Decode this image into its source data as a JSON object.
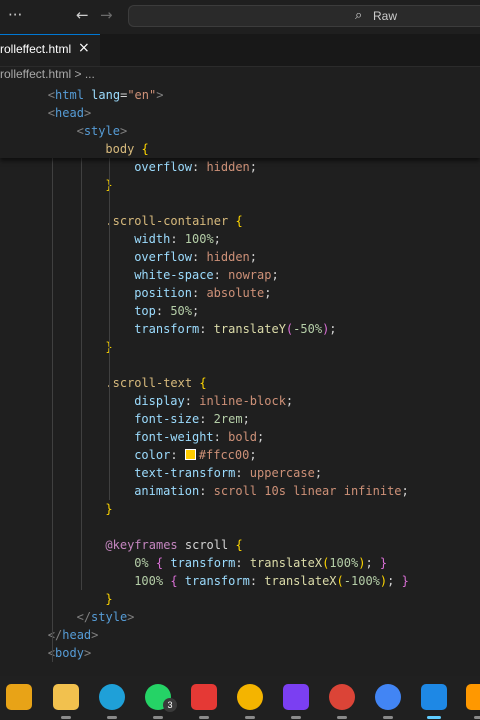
{
  "titlebar": {
    "menu_label": "···",
    "back_label": "←",
    "forward_label": "→",
    "search_placeholder": "Raw"
  },
  "tab": {
    "label": "rolleffect.html",
    "close_label": "×"
  },
  "breadcrumb": {
    "file": "rolleffect.html",
    "separator": ">",
    "more": "..."
  },
  "sticky_lines": [
    {
      "indent": 1,
      "tokens": [
        [
          "punct",
          "<"
        ],
        [
          "tag",
          "html"
        ],
        [
          "plain",
          " "
        ],
        [
          "attr",
          "lang"
        ],
        [
          "plain",
          "="
        ],
        [
          "str",
          "\"en\""
        ],
        [
          "punct",
          ">"
        ]
      ]
    },
    {
      "indent": 1,
      "tokens": [
        [
          "punct",
          "<"
        ],
        [
          "tag",
          "head"
        ],
        [
          "punct",
          ">"
        ]
      ]
    },
    {
      "indent": 2,
      "tokens": [
        [
          "punct",
          "<"
        ],
        [
          "tag",
          "style"
        ],
        [
          "punct",
          ">"
        ]
      ]
    },
    {
      "indent": 3,
      "tokens": [
        [
          "sel",
          "body"
        ],
        [
          "plain",
          " "
        ],
        [
          "brace",
          "{"
        ]
      ]
    }
  ],
  "code_lines": [
    {
      "indent": 4,
      "tokens": [
        [
          "prop",
          "overflow"
        ],
        [
          "plain",
          ": "
        ],
        [
          "val",
          "hidden"
        ],
        [
          "plain",
          ";"
        ]
      ]
    },
    {
      "indent": 3,
      "tokens": [
        [
          "brace",
          "}"
        ]
      ]
    },
    {
      "indent": 0,
      "tokens": []
    },
    {
      "indent": 3,
      "tokens": [
        [
          "sel",
          ".scroll-container"
        ],
        [
          "plain",
          " "
        ],
        [
          "brace",
          "{"
        ]
      ]
    },
    {
      "indent": 4,
      "tokens": [
        [
          "prop",
          "width"
        ],
        [
          "plain",
          ": "
        ],
        [
          "num",
          "100%"
        ],
        [
          "plain",
          ";"
        ]
      ]
    },
    {
      "indent": 4,
      "tokens": [
        [
          "prop",
          "overflow"
        ],
        [
          "plain",
          ": "
        ],
        [
          "val",
          "hidden"
        ],
        [
          "plain",
          ";"
        ]
      ]
    },
    {
      "indent": 4,
      "tokens": [
        [
          "prop",
          "white-space"
        ],
        [
          "plain",
          ": "
        ],
        [
          "val",
          "nowrap"
        ],
        [
          "plain",
          ";"
        ]
      ]
    },
    {
      "indent": 4,
      "tokens": [
        [
          "prop",
          "position"
        ],
        [
          "plain",
          ": "
        ],
        [
          "val",
          "absolute"
        ],
        [
          "plain",
          ";"
        ]
      ]
    },
    {
      "indent": 4,
      "tokens": [
        [
          "prop",
          "top"
        ],
        [
          "plain",
          ": "
        ],
        [
          "num",
          "50%"
        ],
        [
          "plain",
          ";"
        ]
      ]
    },
    {
      "indent": 4,
      "tokens": [
        [
          "prop",
          "transform"
        ],
        [
          "plain",
          ": "
        ],
        [
          "func",
          "translateY"
        ],
        [
          "brace2",
          "("
        ],
        [
          "num",
          "-50%"
        ],
        [
          "brace2",
          ")"
        ],
        [
          "plain",
          ";"
        ]
      ]
    },
    {
      "indent": 3,
      "tokens": [
        [
          "brace",
          "}"
        ]
      ]
    },
    {
      "indent": 0,
      "tokens": []
    },
    {
      "indent": 3,
      "tokens": [
        [
          "sel",
          ".scroll-text"
        ],
        [
          "plain",
          " "
        ],
        [
          "brace",
          "{"
        ]
      ]
    },
    {
      "indent": 4,
      "tokens": [
        [
          "prop",
          "display"
        ],
        [
          "plain",
          ": "
        ],
        [
          "val",
          "inline-block"
        ],
        [
          "plain",
          ";"
        ]
      ]
    },
    {
      "indent": 4,
      "tokens": [
        [
          "prop",
          "font-size"
        ],
        [
          "plain",
          ": "
        ],
        [
          "num",
          "2rem"
        ],
        [
          "plain",
          ";"
        ]
      ]
    },
    {
      "indent": 4,
      "tokens": [
        [
          "prop",
          "font-weight"
        ],
        [
          "plain",
          ": "
        ],
        [
          "val",
          "bold"
        ],
        [
          "plain",
          ";"
        ]
      ]
    },
    {
      "indent": 4,
      "tokens": [
        [
          "prop",
          "color"
        ],
        [
          "plain",
          ": "
        ],
        [
          "swatch",
          ""
        ],
        [
          "val",
          "#ffcc00"
        ],
        [
          "plain",
          ";"
        ]
      ]
    },
    {
      "indent": 4,
      "tokens": [
        [
          "prop",
          "text-transform"
        ],
        [
          "plain",
          ": "
        ],
        [
          "val",
          "uppercase"
        ],
        [
          "plain",
          ";"
        ]
      ]
    },
    {
      "indent": 4,
      "tokens": [
        [
          "prop",
          "animation"
        ],
        [
          "plain",
          ": "
        ],
        [
          "val",
          "scroll 10s linear infinite"
        ],
        [
          "plain",
          ";"
        ]
      ]
    },
    {
      "indent": 3,
      "tokens": [
        [
          "brace",
          "}"
        ]
      ]
    },
    {
      "indent": 0,
      "tokens": []
    },
    {
      "indent": 3,
      "tokens": [
        [
          "at",
          "@keyframes"
        ],
        [
          "plain",
          " scroll "
        ],
        [
          "brace",
          "{"
        ]
      ]
    },
    {
      "indent": 4,
      "tokens": [
        [
          "num",
          "0%"
        ],
        [
          "plain",
          " "
        ],
        [
          "brace2",
          "{"
        ],
        [
          "plain",
          " "
        ],
        [
          "prop",
          "transform"
        ],
        [
          "plain",
          ": "
        ],
        [
          "func",
          "translateX"
        ],
        [
          "brace",
          "("
        ],
        [
          "num",
          "100%"
        ],
        [
          "brace",
          ")"
        ],
        [
          "plain",
          "; "
        ],
        [
          "brace2",
          "}"
        ]
      ]
    },
    {
      "indent": 4,
      "tokens": [
        [
          "num",
          "100%"
        ],
        [
          "plain",
          " "
        ],
        [
          "brace2",
          "{"
        ],
        [
          "plain",
          " "
        ],
        [
          "prop",
          "transform"
        ],
        [
          "plain",
          ": "
        ],
        [
          "func",
          "translateX"
        ],
        [
          "brace",
          "("
        ],
        [
          "num",
          "-100%"
        ],
        [
          "brace",
          ")"
        ],
        [
          "plain",
          "; "
        ],
        [
          "brace2",
          "}"
        ]
      ]
    },
    {
      "indent": 3,
      "tokens": [
        [
          "brace",
          "}"
        ]
      ]
    },
    {
      "indent": 2,
      "tokens": [
        [
          "punct",
          "</"
        ],
        [
          "tag",
          "style"
        ],
        [
          "punct",
          ">"
        ]
      ]
    },
    {
      "indent": 1,
      "tokens": [
        [
          "punct",
          "</"
        ],
        [
          "tag",
          "head"
        ],
        [
          "punct",
          ">"
        ]
      ]
    },
    {
      "indent": 1,
      "tokens": [
        [
          "punct",
          "<"
        ],
        [
          "tag",
          "body"
        ],
        [
          "punct",
          ">"
        ]
      ]
    }
  ],
  "colors": {
    "accent": "#0078d4",
    "editor_bg": "#1f1f1f",
    "swatch": "#ffcc00"
  },
  "taskbar": {
    "icons": [
      {
        "name": "copilot-icon",
        "color": "#e8a317"
      },
      {
        "name": "file-explorer-icon",
        "color": "#f2c14e"
      },
      {
        "name": "edge-icon",
        "color": "#1fa0d8"
      },
      {
        "name": "whatsapp-icon",
        "color": "#25d366",
        "badge": "3"
      },
      {
        "name": "anydesk-icon",
        "color": "#e53935"
      },
      {
        "name": "chrome-canary-icon",
        "color": "#f4b400"
      },
      {
        "name": "phpstorm-icon",
        "color": "#7b3ff2"
      },
      {
        "name": "chrome-icon",
        "color": "#db4437"
      },
      {
        "name": "android-studio-icon",
        "color": "#4285f4"
      },
      {
        "name": "vscode-icon",
        "color": "#1e88e5"
      },
      {
        "name": "sublime-icon",
        "color": "#ff9800"
      }
    ]
  }
}
